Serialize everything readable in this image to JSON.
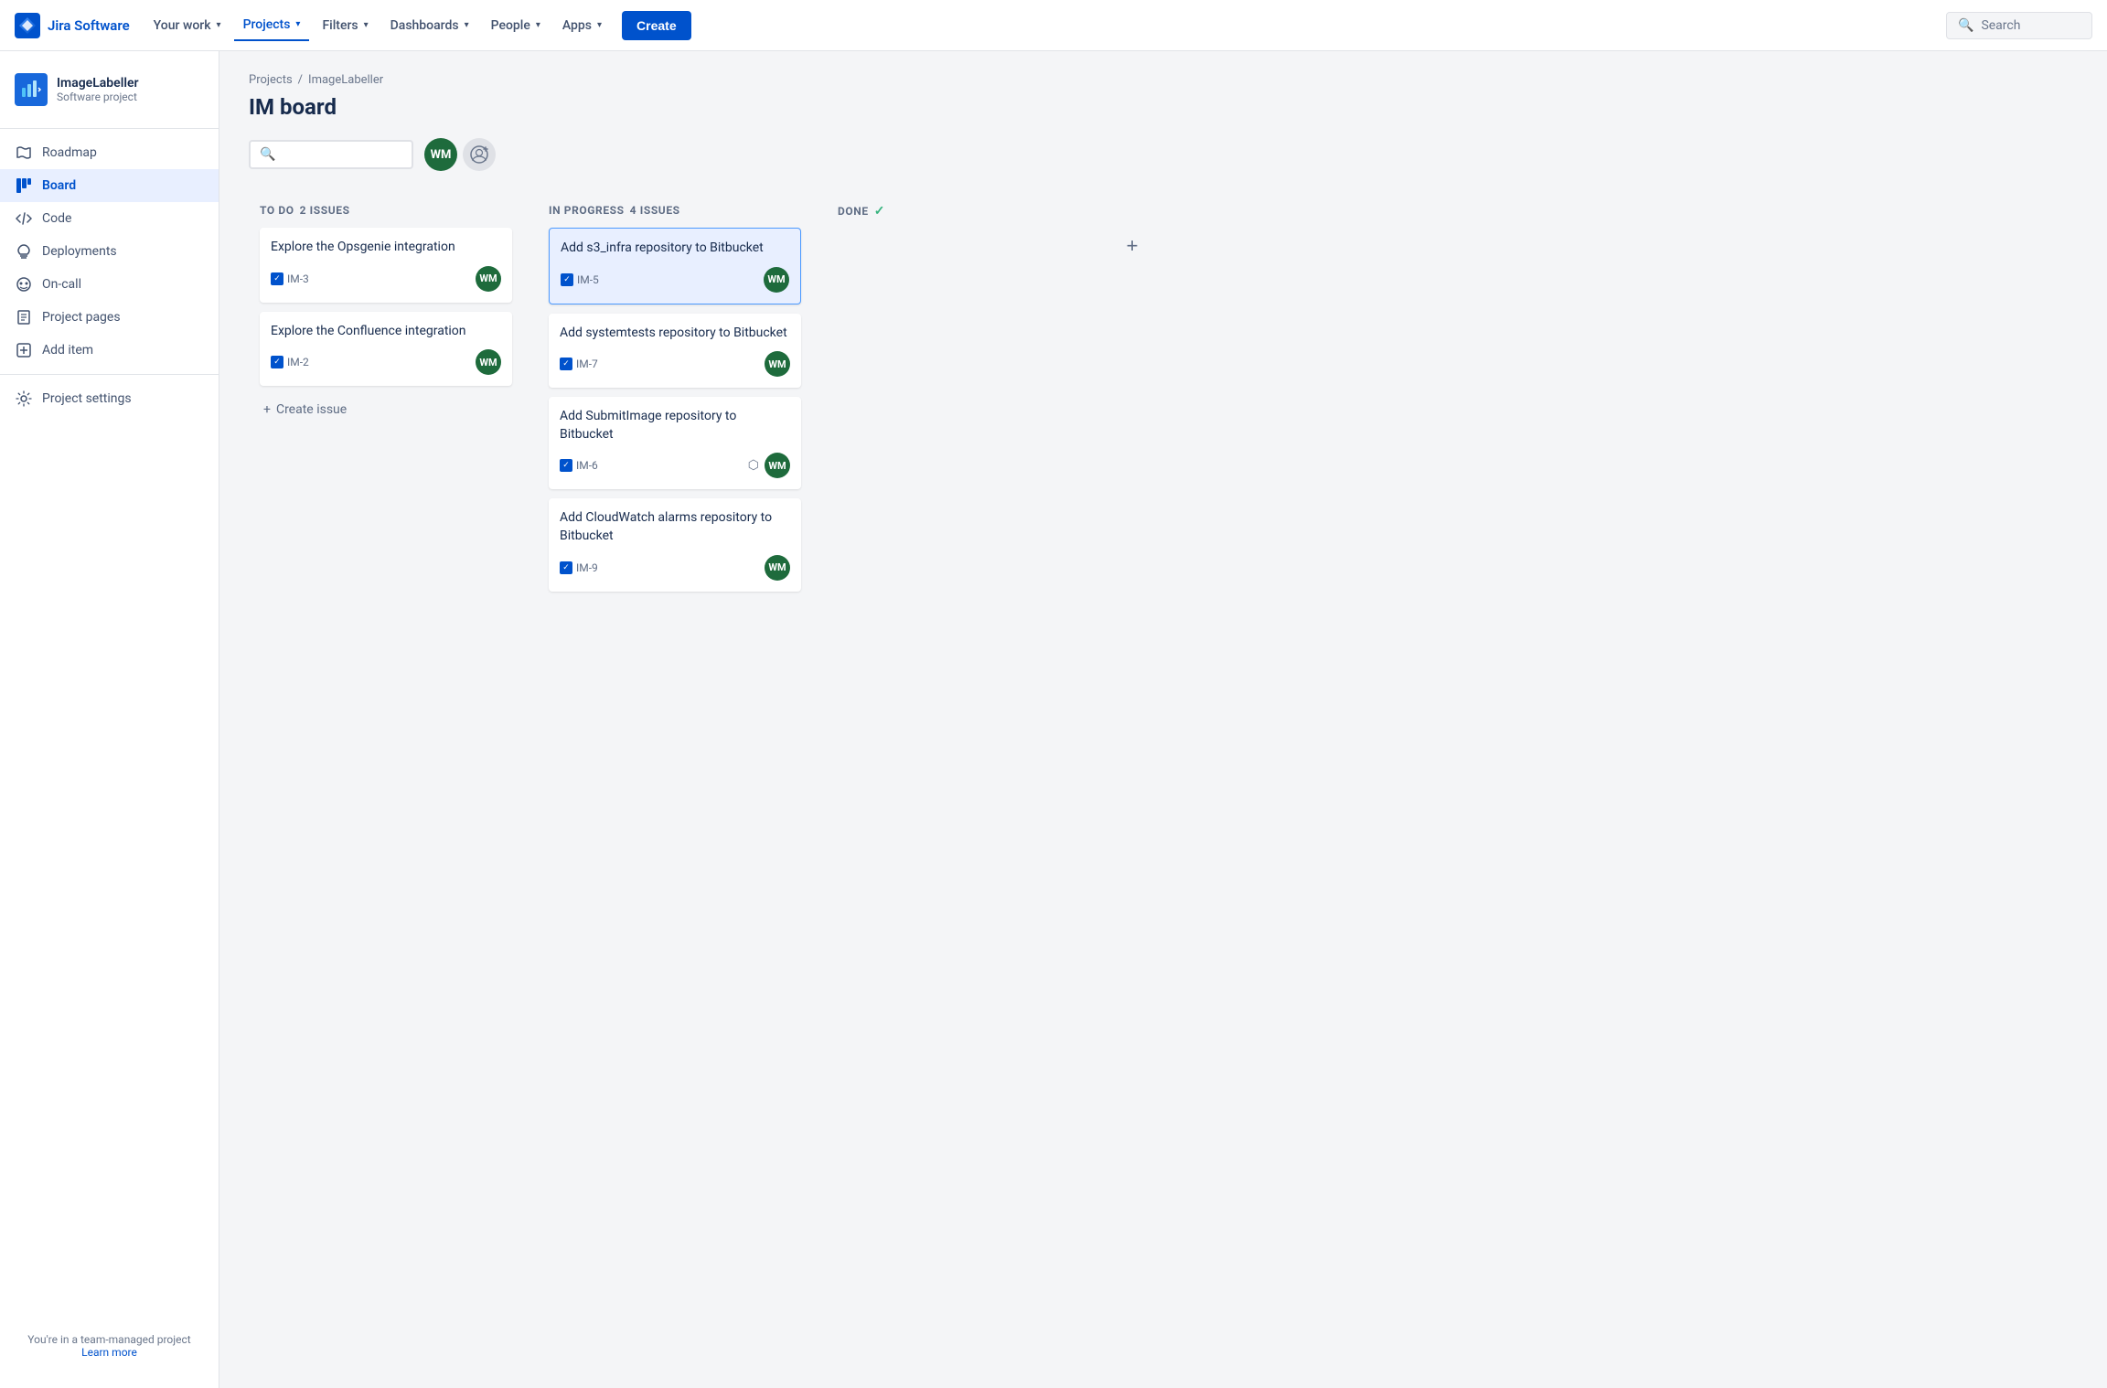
{
  "nav": {
    "logo_text": "Jira Software",
    "items": [
      {
        "id": "your-work",
        "label": "Your work",
        "has_dropdown": true,
        "active": false
      },
      {
        "id": "projects",
        "label": "Projects",
        "has_dropdown": true,
        "active": true
      },
      {
        "id": "filters",
        "label": "Filters",
        "has_dropdown": true,
        "active": false
      },
      {
        "id": "dashboards",
        "label": "Dashboards",
        "has_dropdown": true,
        "active": false
      },
      {
        "id": "people",
        "label": "People",
        "has_dropdown": true,
        "active": false
      },
      {
        "id": "apps",
        "label": "Apps",
        "has_dropdown": true,
        "active": false
      }
    ],
    "create_label": "Create",
    "search_placeholder": "Search"
  },
  "sidebar": {
    "project_name": "ImageLabeller",
    "project_type": "Software project",
    "items": [
      {
        "id": "roadmap",
        "label": "Roadmap",
        "icon": "🗺"
      },
      {
        "id": "board",
        "label": "Board",
        "icon": "⊞",
        "active": true
      },
      {
        "id": "code",
        "label": "Code",
        "icon": "</>"
      },
      {
        "id": "deployments",
        "label": "Deployments",
        "icon": "☁"
      },
      {
        "id": "on-call",
        "label": "On-call",
        "icon": "📞"
      },
      {
        "id": "project-pages",
        "label": "Project pages",
        "icon": "📄"
      },
      {
        "id": "add-item",
        "label": "Add item",
        "icon": "+"
      }
    ],
    "settings_label": "Project settings",
    "footer_text": "You're in a team-managed project",
    "learn_more": "Learn more"
  },
  "breadcrumb": {
    "projects_label": "Projects",
    "separator": "/",
    "current": "ImageLabeller"
  },
  "page_title": "IM board",
  "board": {
    "columns": [
      {
        "id": "todo",
        "title": "TO DO",
        "issue_count": "2 ISSUES",
        "cards": [
          {
            "id": "IM-3",
            "title": "Explore the Opsgenie integration",
            "assignee_initials": "WM",
            "assignee_color": "#1e6b3c",
            "selected": false
          },
          {
            "id": "IM-2",
            "title": "Explore the Confluence integration",
            "assignee_initials": "WM",
            "assignee_color": "#1e6b3c",
            "selected": false
          }
        ],
        "create_issue_label": "Create issue"
      },
      {
        "id": "in-progress",
        "title": "IN PROGRESS",
        "issue_count": "4 ISSUES",
        "cards": [
          {
            "id": "IM-5",
            "title": "Add s3_infra repository to Bitbucket",
            "assignee_initials": "WM",
            "assignee_color": "#1e6b3c",
            "selected": true
          },
          {
            "id": "IM-7",
            "title": "Add systemtests repository to Bitbucket",
            "assignee_initials": "WM",
            "assignee_color": "#1e6b3c",
            "selected": false
          },
          {
            "id": "IM-6",
            "title": "Add SubmitImage repository to Bitbucket",
            "assignee_initials": "WM",
            "assignee_color": "#1e6b3c",
            "selected": false,
            "has_priority": true
          },
          {
            "id": "IM-9",
            "title": "Add CloudWatch alarms repository to Bitbucket",
            "assignee_initials": "WM",
            "assignee_color": "#1e6b3c",
            "selected": false
          }
        ]
      },
      {
        "id": "done",
        "title": "DONE",
        "issue_count": "",
        "cards": []
      }
    ]
  },
  "avatars": [
    {
      "initials": "WM",
      "color": "#1e6b3c"
    }
  ]
}
